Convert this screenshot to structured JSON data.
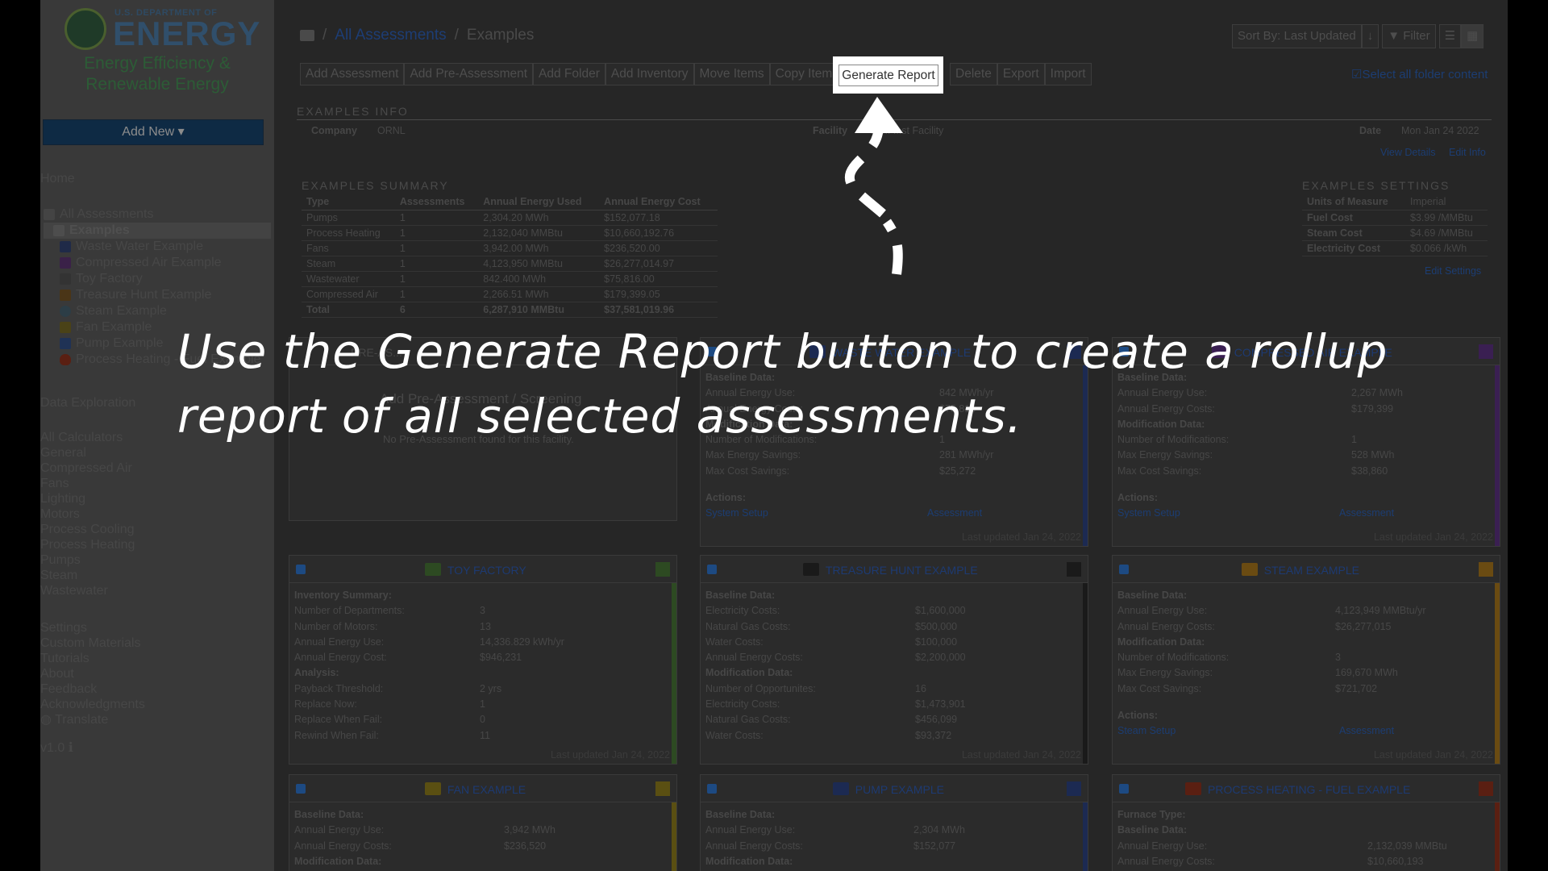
{
  "logo": {
    "top": "U.S. DEPARTMENT OF",
    "main": "ENERGY",
    "sub1": "Energy Efficiency &",
    "sub2": "Renewable Energy"
  },
  "sidebar": {
    "add_new": "Add New",
    "home": "Home",
    "all_assessments": "All Assessments",
    "tree": [
      {
        "label": "Examples",
        "selected": true
      },
      {
        "label": "Waste Water Example"
      },
      {
        "label": "Compressed Air Example"
      },
      {
        "label": "Toy Factory"
      },
      {
        "label": "Treasure Hunt Example"
      },
      {
        "label": "Steam Example"
      },
      {
        "label": "Fan Example"
      },
      {
        "label": "Pump Example"
      },
      {
        "label": "Process Heating - Fuel Example"
      }
    ],
    "data_exploration": "Data Exploration",
    "calculators": [
      "All Calculators",
      "General",
      "Compressed Air",
      "Fans",
      "Lighting",
      "Motors",
      "Process Cooling",
      "Process Heating",
      "Pumps",
      "Steam",
      "Wastewater"
    ],
    "misc": [
      "Settings",
      "Custom Materials",
      "Tutorials",
      "About",
      "Feedback",
      "Acknowledgments",
      "Translate"
    ],
    "version": "v1.0"
  },
  "breadcrumb": {
    "root": "All Assessments",
    "sep": "/",
    "current": "Examples"
  },
  "sort": {
    "label": "Sort By: Last Updated",
    "filter": "Filter"
  },
  "toolbar": [
    "Add Assessment",
    "Add Pre-Assessment",
    "Add Folder",
    "Add Inventory",
    "Move Items",
    "Copy Items",
    "Generate Report",
    "Delete",
    "Export",
    "Import"
  ],
  "select_all": "Select all folder content",
  "info": {
    "title": "EXAMPLES INFO",
    "company_label": "Company",
    "company": "ORNL",
    "facility_label": "Facility",
    "facility": "Co... ...st Facility",
    "date_label": "Date",
    "date": "Mon Jan 24 2022",
    "view_details": "View Details",
    "edit_info": "Edit Info"
  },
  "summary": {
    "title": "EXAMPLES SUMMARY",
    "headers": [
      "Type",
      "Assessments",
      "Annual Energy Used",
      "Annual Energy Cost"
    ],
    "rows": [
      [
        "Pumps",
        "1",
        "2,304.20 MWh",
        "$152,077.18"
      ],
      [
        "Process Heating",
        "1",
        "2,132,040 MMBtu",
        "$10,660,192.76"
      ],
      [
        "Fans",
        "1",
        "3,942.00 MWh",
        "$236,520.00"
      ],
      [
        "Steam",
        "1",
        "4,123,950 MMBtu",
        "$26,277,014.97"
      ],
      [
        "Wastewater",
        "1",
        "842.400 MWh",
        "$75,816.00"
      ],
      [
        "Compressed Air",
        "1",
        "2,266.51 MWh",
        "$179,399.05"
      ]
    ],
    "total": [
      "Total",
      "6",
      "6,287,910 MMBtu",
      "$37,581,019.96"
    ]
  },
  "settings": {
    "title": "EXAMPLES SETTINGS",
    "rows": [
      [
        "Units of Measure",
        "Imperial"
      ],
      [
        "Fuel Cost",
        "$3.99 /MMBtu"
      ],
      [
        "Steam Cost",
        "$4.69 /MMBtu"
      ],
      [
        "Electricity Cost",
        "$0.066 /kWh"
      ]
    ],
    "edit": "Edit Settings"
  },
  "cards": {
    "pre": {
      "title": "PRE-AS...",
      "line1": "Add Pre-Assessment / Screening",
      "line2": "No Pre-Assessment found for this facility."
    },
    "wastewater": {
      "title": "WASTE WATER EXAMPLE",
      "rows": [
        [
          "Baseline Data:",
          ""
        ],
        [
          "Annual Energy Use:",
          "842 MWh/yr"
        ],
        [
          "Annual Energy Costs:",
          "$75,816"
        ],
        [
          "Modification Data:",
          ""
        ],
        [
          "Number of Modifications:",
          "1"
        ],
        [
          "Max Energy Savings:",
          "281 MWh/yr"
        ],
        [
          "Max Cost Savings:",
          "$25,272"
        ]
      ],
      "actions": "Actions:",
      "link1": "System Setup",
      "link2": "Assessment",
      "updated": "Last updated Jan 24, 2022"
    },
    "compressed": {
      "title": "COMPRESSED AIR EXAMPLE",
      "rows": [
        [
          "Baseline Data:",
          ""
        ],
        [
          "Annual Energy Use:",
          "2,267 MWh"
        ],
        [
          "Annual Energy Costs:",
          "$179,399"
        ],
        [
          "Modification Data:",
          ""
        ],
        [
          "Number of Modifications:",
          "1"
        ],
        [
          "Max Energy Savings:",
          "528 MWh"
        ],
        [
          "Max Cost Savings:",
          "$38,860"
        ]
      ],
      "actions": "Actions:",
      "link1": "System Setup",
      "link2": "Assessment",
      "updated": "Last updated Jan 24, 2022"
    },
    "toy": {
      "title": "TOY FACTORY",
      "rows": [
        [
          "Inventory Summary:",
          ""
        ],
        [
          "Number of Departments:",
          "3"
        ],
        [
          "Number of Motors:",
          "13"
        ],
        [
          "Annual Energy Use:",
          "14,336.829 kWh/yr"
        ],
        [
          "Annual Energy Cost:",
          "$946,231"
        ],
        [
          "Analysis:",
          ""
        ],
        [
          "Payback Threshold:",
          "2 yrs"
        ],
        [
          "Replace Now:",
          "1"
        ],
        [
          "Replace When Fail:",
          "0"
        ],
        [
          "Rewind When Fail:",
          "11"
        ]
      ],
      "updated": "Last updated Jan 24, 2022"
    },
    "treasure": {
      "title": "TREASURE HUNT EXAMPLE",
      "rows": [
        [
          "Baseline Data:",
          ""
        ],
        [
          "  Electricity Costs:",
          "$1,600,000"
        ],
        [
          "  Natural Gas Costs:",
          "$500,000"
        ],
        [
          "  Water Costs:",
          "$100,000"
        ],
        [
          "Annual Energy Costs:",
          "$2,200,000"
        ],
        [
          "Modification Data:",
          ""
        ],
        [
          "Number of Opportunites:",
          "16"
        ],
        [
          "  Electricity Costs:",
          "$1,473,901"
        ],
        [
          "  Natural Gas Costs:",
          "$456,099"
        ],
        [
          "  Water Costs:",
          "$93,372"
        ]
      ],
      "updated": "Last updated Jan 24, 2022"
    },
    "steam": {
      "title": "STEAM EXAMPLE",
      "rows": [
        [
          "Baseline Data:",
          ""
        ],
        [
          "Annual Energy Use:",
          "4,123,949 MMBtu/yr"
        ],
        [
          "Annual Energy Costs:",
          "$26,277,015"
        ],
        [
          "Modification Data:",
          ""
        ],
        [
          "Number of Modifications:",
          "3"
        ],
        [
          "Max Energy Savings:",
          "169,670 MWh"
        ],
        [
          "Max Cost Savings:",
          "$721,702"
        ]
      ],
      "actions": "Actions:",
      "link1": "Steam Setup",
      "link2": "Assessment",
      "updated": "Last updated Jan 24, 2022"
    },
    "fan": {
      "title": "FAN EXAMPLE",
      "rows": [
        [
          "Baseline Data:",
          ""
        ],
        [
          "Annual Energy Use:",
          "3,942 MWh"
        ],
        [
          "Annual Energy Costs:",
          "$236,520"
        ],
        [
          "Modification Data:",
          ""
        ]
      ]
    },
    "pump": {
      "title": "PUMP EXAMPLE",
      "rows": [
        [
          "Baseline Data:",
          ""
        ],
        [
          "Annual Energy Use:",
          "2,304 MWh"
        ],
        [
          "Annual Energy Costs:",
          "$152,077"
        ],
        [
          "Modification Data:",
          ""
        ]
      ]
    },
    "process": {
      "title": "PROCESS HEATING - FUEL EXAMPLE",
      "rows": [
        [
          "Furnace Type:",
          ""
        ],
        [
          "Baseline Data:",
          ""
        ],
        [
          "Annual Energy Use:",
          "2,132,039 MMBtu"
        ],
        [
          "Annual Energy Costs:",
          "$10,660,193"
        ]
      ]
    }
  },
  "caption": "Use the Generate Report button to create a rollup report of all selected assessments.",
  "colors": {
    "highlight": "#ffffff",
    "link": "#1c3d72",
    "accent_blue": "#0e2a44"
  }
}
